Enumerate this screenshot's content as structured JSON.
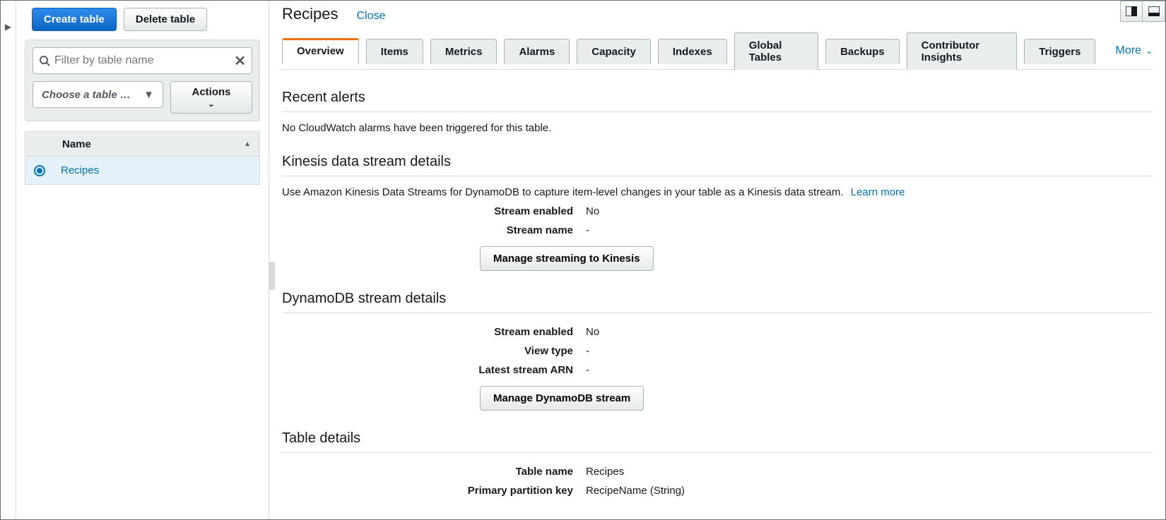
{
  "sidebar": {
    "create_label": "Create table",
    "delete_label": "Delete table",
    "filter_placeholder": "Filter by table name",
    "table_group_placeholder": "Choose a table …",
    "actions_label": "Actions",
    "name_header": "Name",
    "rows": [
      {
        "name": "Recipes"
      }
    ]
  },
  "header": {
    "title": "Recipes",
    "close": "Close"
  },
  "tabs": [
    "Overview",
    "Items",
    "Metrics",
    "Alarms",
    "Capacity",
    "Indexes",
    "Global Tables",
    "Backups",
    "Contributor Insights",
    "Triggers"
  ],
  "active_tab": "Overview",
  "more_label": "More",
  "sections": {
    "recent_alerts": {
      "title": "Recent alerts",
      "text": "No CloudWatch alarms have been triggered for this table."
    },
    "kinesis": {
      "title": "Kinesis data stream details",
      "text": "Use Amazon Kinesis Data Streams for DynamoDB to capture item-level changes in your table as a Kinesis data stream.",
      "learn_more": "Learn more",
      "rows": [
        {
          "k": "Stream enabled",
          "v": "No"
        },
        {
          "k": "Stream name",
          "v": "-"
        }
      ],
      "button": "Manage streaming to Kinesis"
    },
    "ddb_stream": {
      "title": "DynamoDB stream details",
      "rows": [
        {
          "k": "Stream enabled",
          "v": "No"
        },
        {
          "k": "View type",
          "v": "-"
        },
        {
          "k": "Latest stream ARN",
          "v": "-"
        }
      ],
      "button": "Manage DynamoDB stream"
    },
    "table_details": {
      "title": "Table details",
      "rows": [
        {
          "k": "Table name",
          "v": "Recipes"
        },
        {
          "k": "Primary partition key",
          "v": "RecipeName (String)"
        }
      ]
    }
  }
}
